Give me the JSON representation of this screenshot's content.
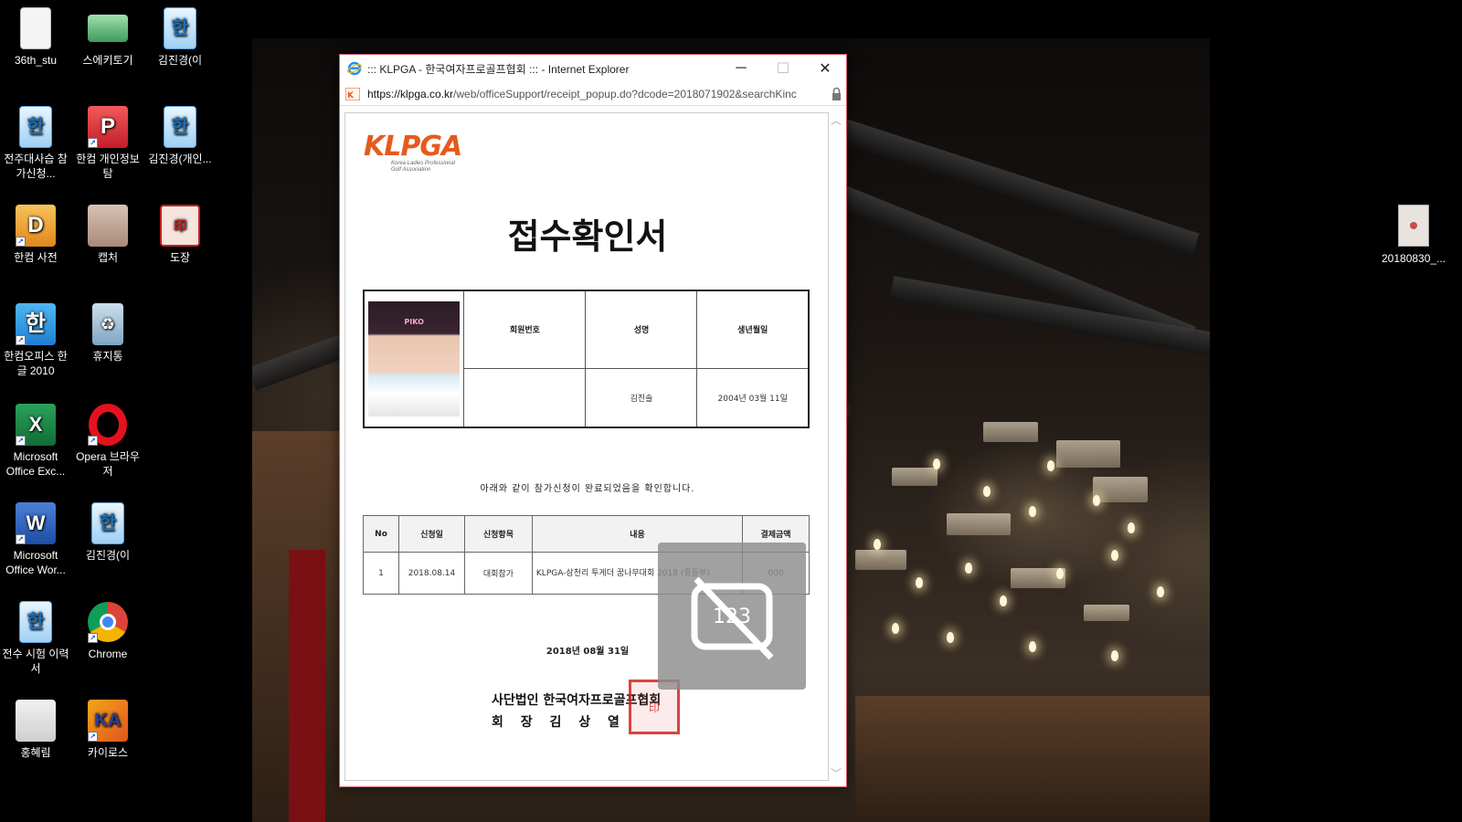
{
  "desktop_icons": [
    {
      "label": "36th_stu",
      "icon": "document-icon"
    },
    {
      "label": "스에키토기",
      "icon": "image-icon"
    },
    {
      "label": "김진경(이",
      "icon": "hwp-file-icon"
    },
    {
      "label": "전주대사습 참가신청...",
      "icon": "hwp-file-icon"
    },
    {
      "label": "한컴 개인정보탐",
      "icon": "hancom-privacy-icon"
    },
    {
      "label": "김진경(개인...",
      "icon": "hwp-file-icon"
    },
    {
      "label": "한컴 사전",
      "icon": "hancom-dictionary-icon"
    },
    {
      "label": "캡처",
      "icon": "photo-icon"
    },
    {
      "label": "도장",
      "icon": "seal-icon"
    },
    {
      "label": "한컴오피스 한글 2010",
      "icon": "hancom-office-icon"
    },
    {
      "label": "휴지통",
      "icon": "recycle-bin-icon"
    },
    {
      "label": "Microsoft Office Exc...",
      "icon": "excel-icon"
    },
    {
      "label": "Opera 브라우저",
      "icon": "opera-icon"
    },
    {
      "label": "Microsoft Office Wor...",
      "icon": "word-icon"
    },
    {
      "label": "김진경(이",
      "icon": "hwp-file-icon"
    },
    {
      "label": "전수 시험 이력서",
      "icon": "hwp-file-icon"
    },
    {
      "label": "Chrome",
      "icon": "chrome-icon"
    },
    {
      "label": "홍혜림",
      "icon": "photo-icon"
    },
    {
      "label": "카이로스",
      "icon": "kairos-icon"
    }
  ],
  "right_file": {
    "label": "20180830_..."
  },
  "ie_window": {
    "title": "::: KLPGA - 한국여자프로골프협회 ::: - Internet Explorer",
    "url_domain": "https://klpga.co.kr",
    "url_path": "/web/officeSupport/receipt_popup.do?dcode=2018071902&searchKinc",
    "minimize": "─",
    "maximize": "☐",
    "close": "✕"
  },
  "document": {
    "logo": "KLPGA",
    "logo_sub1": "Korea Ladies Professional",
    "logo_sub2": "Golf Association",
    "photo_cap": "PIKO",
    "title": "접수확인서",
    "info_headers": {
      "member_no": "회원번호",
      "name": "성명",
      "birth": "생년월일"
    },
    "info_values": {
      "member_no": "",
      "name": "김진솔",
      "birth": "2004년 03월 11일"
    },
    "confirm_text": "아래와 같이 참가신청이 완료되었음을 확인합니다.",
    "detail_headers": [
      "No",
      "신청일",
      "신청항목",
      "내용",
      "결제금액"
    ],
    "detail_rows": [
      {
        "no": "1",
        "date": "2018.08.14",
        "item": "대회참가",
        "content": "KLPGA-삼천리 투게더 꿈나무대회 2018 (중등부)",
        "amount": "000"
      }
    ],
    "date": "2018년 08월 31일",
    "org": "사단법인  한국여자프로골프협회",
    "chairman": "회 장 김 상 열",
    "stamp": "印"
  },
  "overlay": {
    "icon": "no-screenshot-icon",
    "text": "123"
  }
}
